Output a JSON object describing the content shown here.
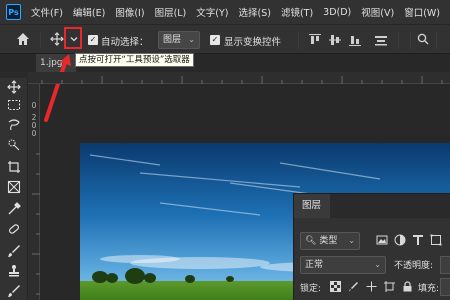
{
  "app": {
    "logo_text": "Ps"
  },
  "menu": [
    "文件(F)",
    "编辑(E)",
    "图像(I)",
    "图层(L)",
    "文字(Y)",
    "选择(S)",
    "滤镜(T)",
    "3D(D)",
    "视图(V)",
    "窗口(W)"
  ],
  "options_bar": {
    "auto_select_label": "自动选择：",
    "auto_select_checked": true,
    "auto_select_target": "图层",
    "show_transform_label": "显示变换控件",
    "show_transform_checked": true
  },
  "tooltip": {
    "text": "点按可打开“工具预设”选取器"
  },
  "document": {
    "tab_label": "1.jpg"
  },
  "ruler": {
    "left_labels": [
      "0",
      "2",
      "0",
      "0"
    ]
  },
  "layers_panel": {
    "tab_label": "图层",
    "filter_kind": "类型",
    "blend_mode": "正常",
    "opacity_label": "不透明度:",
    "lock_label": "锁定:",
    "fill_label": "填充:"
  },
  "colors": {
    "accent_highlight": "#e8282b",
    "ui_dark": "#323232",
    "canvas_bg": "#282828"
  }
}
